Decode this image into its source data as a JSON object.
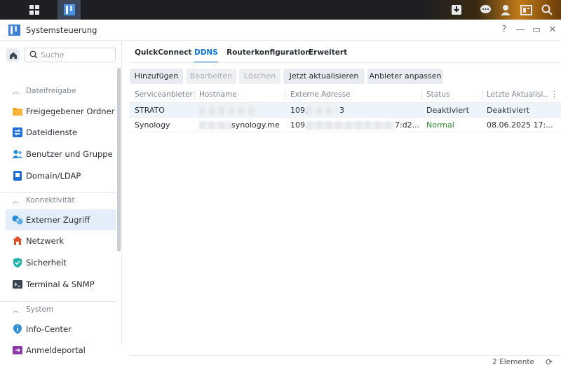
{
  "window": {
    "title": "Systemsteuerung",
    "controls": [
      "?",
      "—",
      "▭",
      "✕"
    ]
  },
  "sidebar": {
    "search_placeholder": "Suche",
    "sections": [
      {
        "label": "Dateifreigabe",
        "items": [
          {
            "label": "Freigegebener Ordner",
            "icon": "folder-icon",
            "color": "#f0a020"
          },
          {
            "label": "Dateidienste",
            "icon": "file-services-icon",
            "color": "#1e6fd9"
          },
          {
            "label": "Benutzer und Gruppe",
            "icon": "users-icon",
            "color": "#2a8fd8"
          },
          {
            "label": "Domain/LDAP",
            "icon": "domain-icon",
            "color": "#1e6fd9"
          }
        ]
      },
      {
        "label": "Konnektivität",
        "items": [
          {
            "label": "Externer Zugriff",
            "icon": "external-access-icon",
            "color": "#2a8fd8",
            "active": true
          },
          {
            "label": "Netzwerk",
            "icon": "network-icon",
            "color": "#e05030"
          },
          {
            "label": "Sicherheit",
            "icon": "shield-icon",
            "color": "#1fb5a8"
          },
          {
            "label": "Terminal & SNMP",
            "icon": "terminal-icon",
            "color": "#3a4250"
          }
        ]
      },
      {
        "label": "System",
        "items": [
          {
            "label": "Info-Center",
            "icon": "info-icon",
            "color": "#2a8fd8"
          },
          {
            "label": "Anmeldeportal",
            "icon": "login-portal-icon",
            "color": "#8a3aa8"
          }
        ]
      }
    ]
  },
  "tabs": [
    {
      "label": "QuickConnect"
    },
    {
      "label": "DDNS",
      "active": true
    },
    {
      "label": "Routerkonfiguration"
    },
    {
      "label": "Erweitert"
    }
  ],
  "toolbar": {
    "add": "Hinzufügen",
    "edit": "Bearbeiten",
    "delete": "Löschen",
    "update_now": "Jetzt aktualisieren",
    "custom_provider": "Anbieter anpassen"
  },
  "table": {
    "headers": [
      "Serviceanbieter",
      "Hostname",
      "Externe Adresse",
      "Status",
      "Letzte Aktualisi..."
    ],
    "rows": [
      {
        "provider": "STRATO",
        "hostname": "",
        "address": "109.",
        "address_end": "3",
        "status": "Deaktiviert",
        "updated": "Deaktiviert"
      },
      {
        "provider": "Synology",
        "hostname": "synology.me",
        "address": "109.",
        "address_end": "7:d2...",
        "status": "Normal",
        "updated": "08.06.2025 17:..."
      }
    ],
    "footer": "2 Elemente",
    "status_ok_color": "#2b8a2b"
  },
  "accent_color": "#0b74d6"
}
